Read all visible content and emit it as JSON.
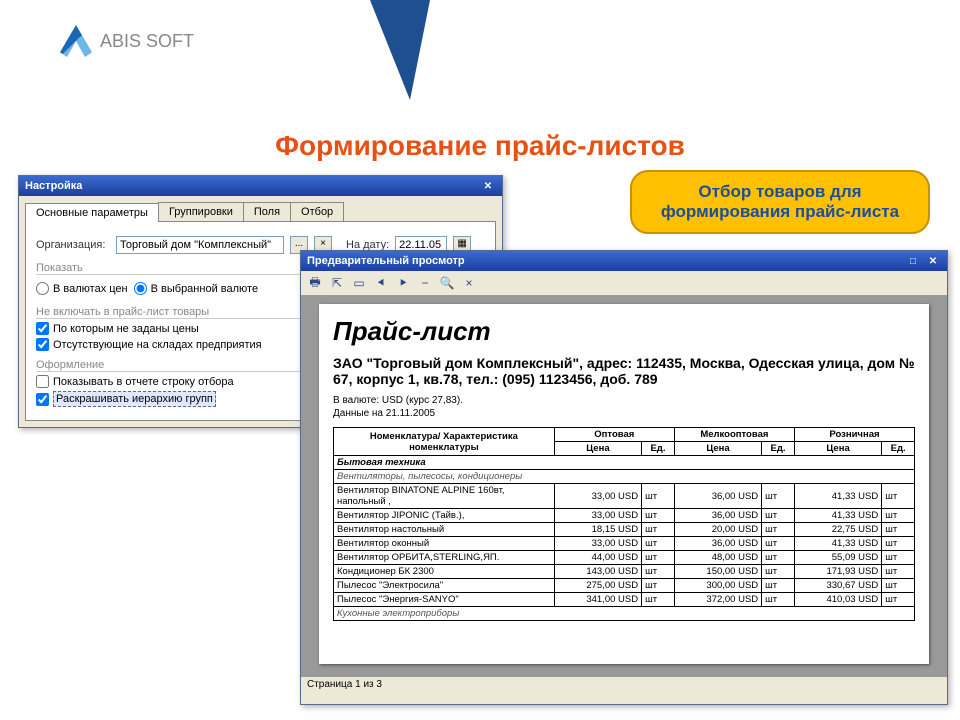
{
  "brand": {
    "name": "ABIS",
    "suffix": "SOFT"
  },
  "page_title": "Формирование прайс-листов",
  "callout": "Отбор товаров для формирования прайс-листа",
  "settings": {
    "title": "Настройка",
    "tabs": [
      "Основные параметры",
      "Группировки",
      "Поля",
      "Отбор"
    ],
    "org_label": "Организация:",
    "org_value": "Торговый дом \"Комплексный\"",
    "date_label": "На дату:",
    "date_value": "22.11.05",
    "groups": {
      "show": "Показать",
      "exclude": "Не включать в прайс-лист товары",
      "decor": "Оформление"
    },
    "radio_curr_price": "В валютах цен",
    "radio_curr_sel": "В выбранной валюте",
    "chk_no_price": "По которым не заданы цены",
    "chk_no_stock": "Отсутствующие на складах предприятия",
    "chk_show_filter": "Показывать в отчете строку отбора",
    "chk_color": "Раскрашивать иерархию групп"
  },
  "preview": {
    "title": "Предварительный просмотр",
    "doc_title": "Прайс-лист",
    "address": "ЗАО \"Торговый дом Комплексный\", адрес: 112435, Москва, Одесская улица, дом № 67, корпус 1, кв.78, тел.: (095) 1123456, доб. 789",
    "meta_curr": "В валюте: USD (курс 27,83).",
    "meta_date": "Данные на 21.11.2005",
    "status": "Страница 1 из 3",
    "headers": {
      "nom": "Номенклатура/ Характеристика номенклатуры",
      "opt": "Оптовая",
      "mopt": "Мелкооптовая",
      "rozn": "Розничная",
      "price": "Цена",
      "unit": "Ед."
    }
  },
  "chart_data": {
    "type": "table",
    "title": "Прайс-лист",
    "columns": [
      "Номенклатура",
      "Оптовая Цена",
      "Оптовая Ед.",
      "Мелкооптовая Цена",
      "Мелкооптовая Ед.",
      "Розничная Цена",
      "Розничная Ед."
    ],
    "rows": [
      {
        "cat": "Бытовая техника"
      },
      {
        "sub": "Вентиляторы, пылесосы, кондиционеры"
      },
      {
        "name": "Вентилятор BINATONE ALPINE 160вт, напольный ,",
        "opt": "33,00 USD",
        "ou": "шт",
        "mopt": "36,00 USD",
        "mu": "шт",
        "rozn": "41,33 USD",
        "ru": "шт"
      },
      {
        "name": "Вентилятор JIPONIC (Тайв.),",
        "opt": "33,00 USD",
        "ou": "шт",
        "mopt": "36,00 USD",
        "mu": "шт",
        "rozn": "41,33 USD",
        "ru": "шт"
      },
      {
        "name": "Вентилятор настольный",
        "opt": "18,15 USD",
        "ou": "шт",
        "mopt": "20,00 USD",
        "mu": "шт",
        "rozn": "22,75 USD",
        "ru": "шт"
      },
      {
        "name": "Вентилятор оконный",
        "opt": "33,00 USD",
        "ou": "шт",
        "mopt": "36,00 USD",
        "mu": "шт",
        "rozn": "41,33 USD",
        "ru": "шт"
      },
      {
        "name": "Вентилятор ОРБИТА,STERLING,ЯП.",
        "opt": "44,00 USD",
        "ou": "шт",
        "mopt": "48,00 USD",
        "mu": "шт",
        "rozn": "55,09 USD",
        "ru": "шт"
      },
      {
        "name": "Кондиционер БК 2300",
        "opt": "143,00 USD",
        "ou": "шт",
        "mopt": "150,00 USD",
        "mu": "шт",
        "rozn": "171,93 USD",
        "ru": "шт"
      },
      {
        "name": "Пылесос \"Электросила\"",
        "opt": "275,00 USD",
        "ou": "шт",
        "mopt": "300,00 USD",
        "mu": "шт",
        "rozn": "330,67 USD",
        "ru": "шт"
      },
      {
        "name": "Пылесос \"Энергия-SANYO\"",
        "opt": "341,00 USD",
        "ou": "шт",
        "mopt": "372,00 USD",
        "mu": "шт",
        "rozn": "410,03 USD",
        "ru": "шт"
      },
      {
        "sub": "Кухонные электроприборы"
      }
    ]
  }
}
